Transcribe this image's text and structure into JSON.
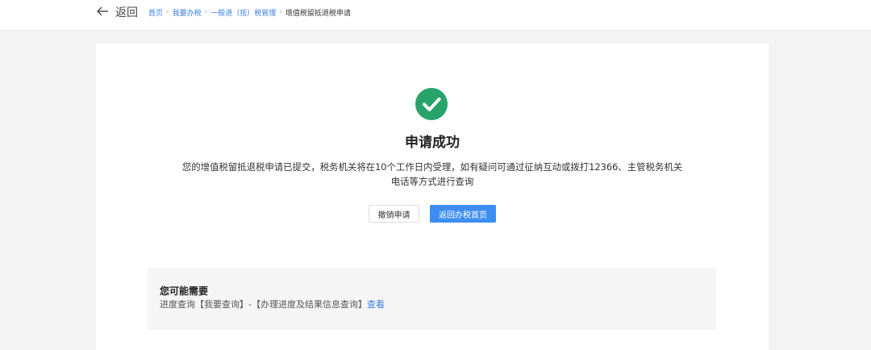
{
  "header": {
    "back_label": "返回",
    "breadcrumb": {
      "items": [
        "首页",
        "我要办税",
        "一般退（抵）税管理"
      ],
      "separator": "›",
      "current": "增值税留抵退税申请"
    }
  },
  "result": {
    "status_icon": "check-circle-icon",
    "status_color": "#29a36a",
    "title": "申请成功",
    "message_line1": "您的增值税留抵退税申请已提交，税务机关将在10个工作日内受理，如有疑问可通过征纳互动或拨打12366、主管税务机关",
    "message_line2": "电话等方式进行查询",
    "cancel_button": "撤销申请",
    "home_button": "返回办税首页"
  },
  "tips": {
    "title": "您可能需要",
    "text": "进度查询【我要查询】-【办理进度及结果信息查询】",
    "link": "查看"
  },
  "colors": {
    "accent": "#3d8ef2",
    "link": "#3b7fe0",
    "success": "#29a36a"
  }
}
